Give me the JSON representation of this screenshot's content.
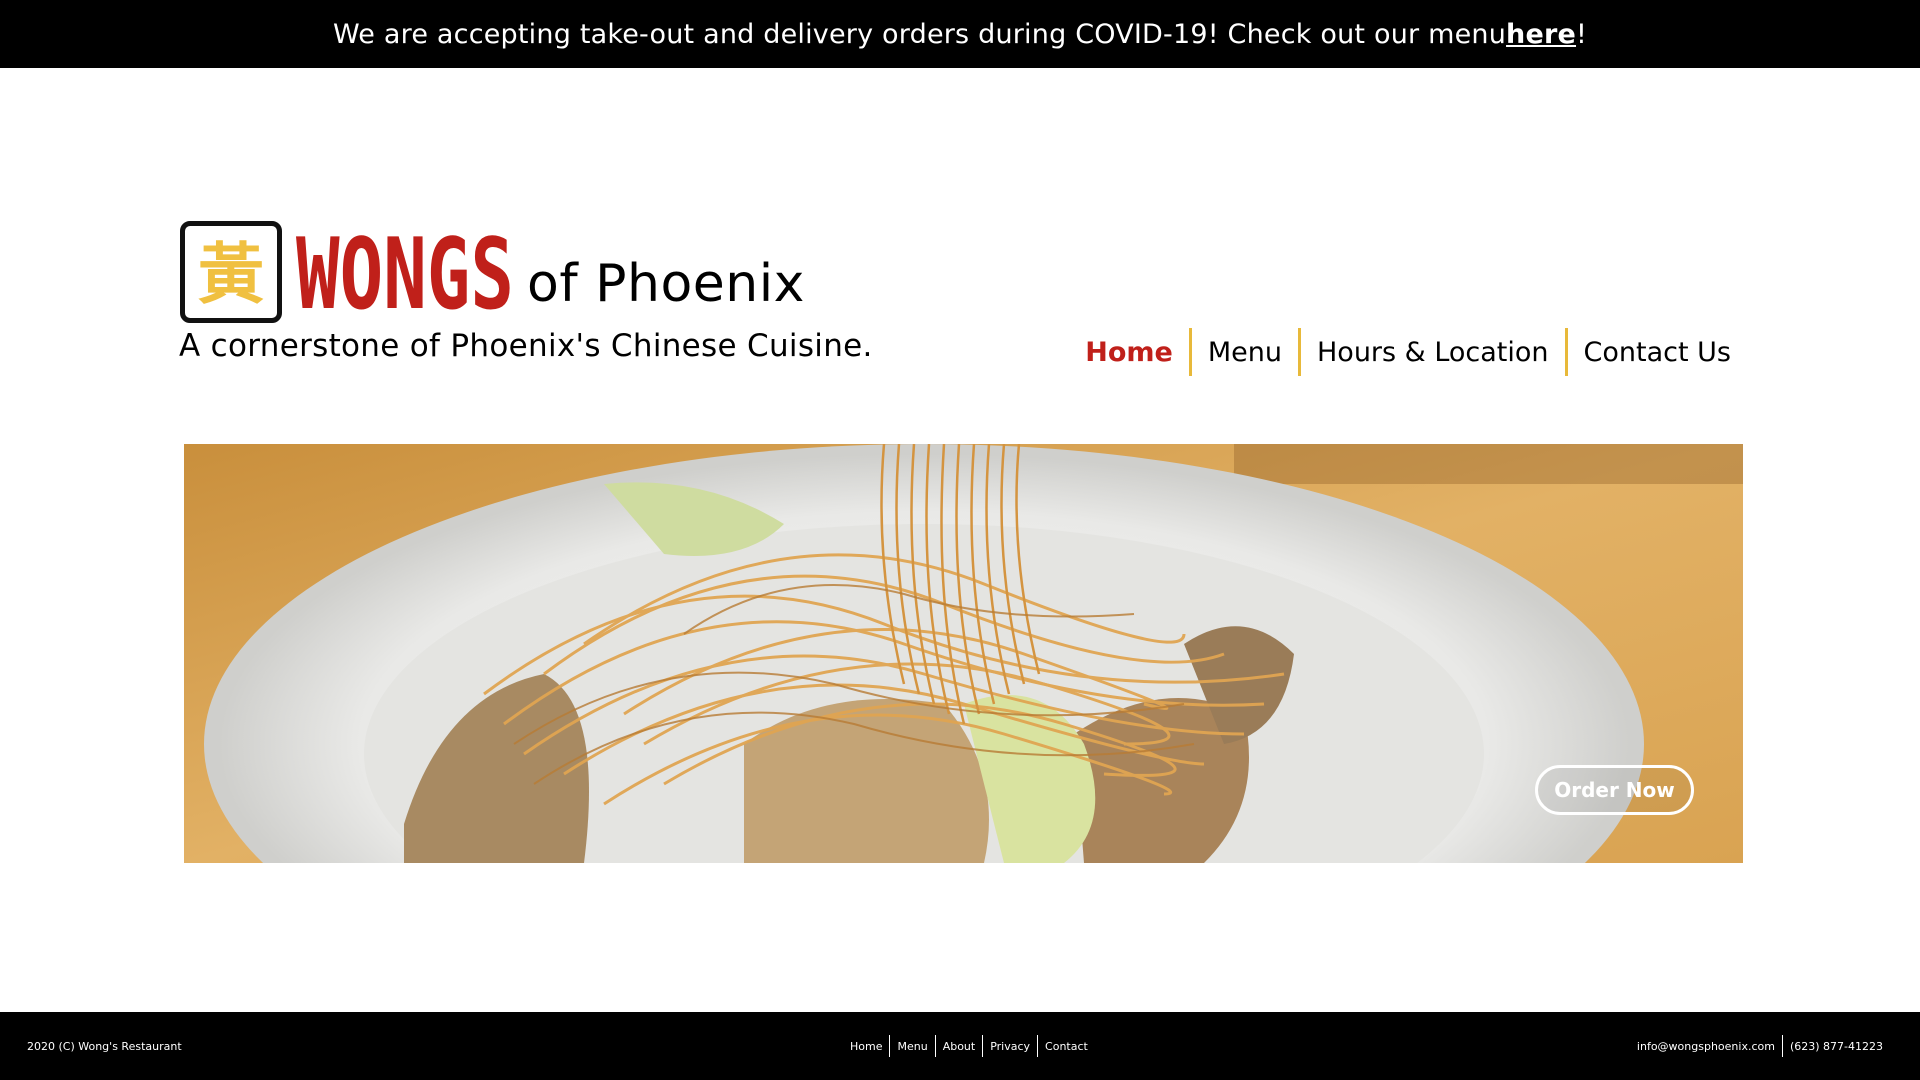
{
  "announcement": {
    "text_before": "We are accepting take-out and delivery orders during COVID-19! Check out our menu ",
    "link_text": "here",
    "text_after": "!"
  },
  "brand": {
    "logo_glyph": "黃",
    "name": "WONGS",
    "suffix": "of Phoenix",
    "tagline": "A cornerstone of Phoenix's Chinese Cuisine.",
    "colors": {
      "red": "#c0201a",
      "gold": "#f0c040"
    }
  },
  "nav": {
    "items": [
      {
        "label": "Home",
        "active": true
      },
      {
        "label": "Menu",
        "active": false
      },
      {
        "label": "Hours & Location",
        "active": false
      },
      {
        "label": "Contact Us",
        "active": false
      }
    ],
    "separator_color": "#e8b93a"
  },
  "hero": {
    "cta_label": "Order Now"
  },
  "footer": {
    "copyright": "2020 (C) Wong's Restaurant",
    "links": [
      "Home",
      "Menu",
      "About",
      "Privacy",
      "Contact"
    ],
    "email": "info@wongsphoenix.com",
    "phone": "(623) 877-41223"
  }
}
